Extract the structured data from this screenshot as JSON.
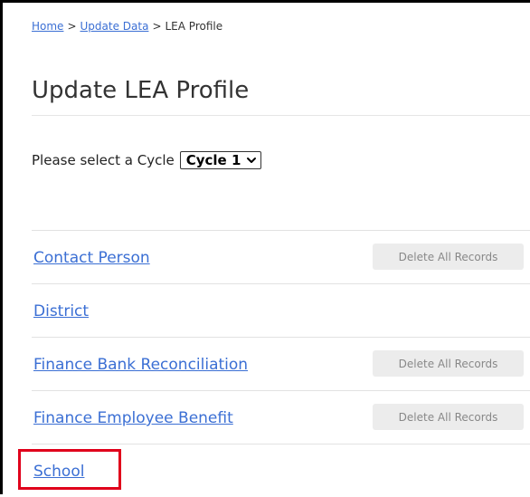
{
  "breadcrumb": {
    "home": "Home",
    "update_data": "Update Data",
    "current": "LEA Profile",
    "separator": ">"
  },
  "page": {
    "title": "Update LEA Profile"
  },
  "cycle": {
    "label": "Please select a Cycle",
    "selected": "Cycle 1"
  },
  "records": [
    {
      "label": "Contact Person",
      "delete_label": "Delete All Records",
      "has_delete": true
    },
    {
      "label": "District",
      "delete_label": "",
      "has_delete": false
    },
    {
      "label": "Finance Bank Reconciliation",
      "delete_label": "Delete All Records",
      "has_delete": true
    },
    {
      "label": "Finance Employee Benefit",
      "delete_label": "Delete All Records",
      "has_delete": true
    },
    {
      "label": "School",
      "delete_label": "",
      "has_delete": false,
      "highlighted": true
    }
  ],
  "colors": {
    "link": "#3b6fd4",
    "highlight": "#e0001b",
    "button_bg": "#ececec"
  }
}
